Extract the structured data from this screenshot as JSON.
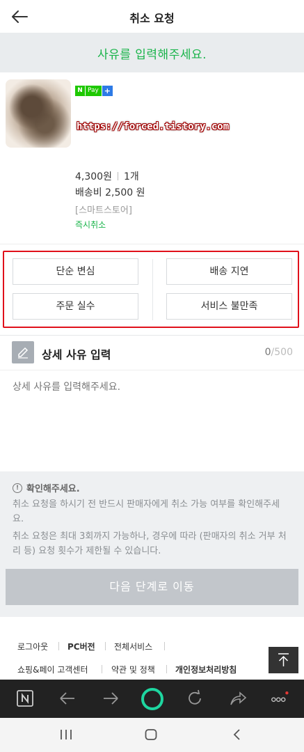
{
  "header": {
    "title": "취소 요청"
  },
  "banner": {
    "text": "사유를 입력해주세요."
  },
  "product": {
    "badge_n": "N",
    "badge_pay": "Pay",
    "badge_plus": "+",
    "watermark": "https://forced.tistory.com",
    "price": "4,300원",
    "quantity": "1개",
    "shipping": "배송비 2,500 원",
    "store": "[스마트스토어]",
    "status": "즉시취소"
  },
  "reasons": [
    "단순 변심",
    "배송 지연",
    "주문 실수",
    "서비스 불만족"
  ],
  "detail": {
    "title": "상세 사유 입력",
    "count_current": "0",
    "count_max": "/500",
    "placeholder": "상세 사유를 입력해주세요."
  },
  "notice": {
    "title": "확인해주세요.",
    "icon_text": "!",
    "para1": "취소 요청을 하시기 전 반드시 판매자에게 취소 가능 여부를 확인해주세요.",
    "para2": "취소 요청은 최대 3회까지 가능하나, 경우에 따라 (판매자의 취소 거부 처리 등) 요청 횟수가 제한될 수 있습니다."
  },
  "next_button": "다음 단계로 이동",
  "footer": {
    "row1": [
      "로그아웃",
      "PC버전",
      "전체서비스"
    ],
    "row2": [
      "쇼핑&페이 고객센터",
      "약관 및 정책",
      "개인정보처리방침"
    ]
  },
  "colors": {
    "accent_green": "#19b44a",
    "highlight_red": "#e0101a",
    "button_disabled": "#c2c6cb",
    "browser_ring": "#1ed6a0"
  },
  "icons": {
    "header": [
      "back-arrow-icon"
    ],
    "detail": [
      "pencil-icon"
    ],
    "footer": [
      "scroll-top-icon"
    ],
    "browser": [
      "naver-home-icon",
      "back-icon",
      "forward-icon",
      "green-dot-icon",
      "refresh-icon",
      "share-icon",
      "more-icon"
    ],
    "system": [
      "recent-apps-icon",
      "home-icon",
      "system-back-icon"
    ]
  }
}
